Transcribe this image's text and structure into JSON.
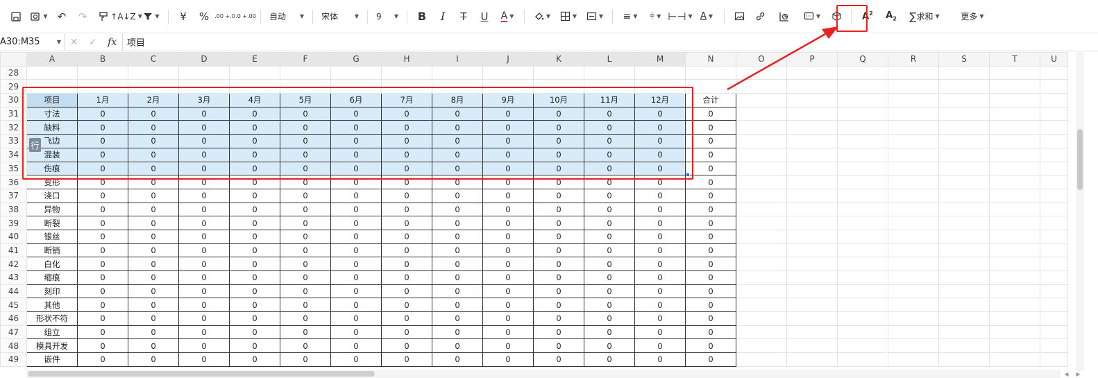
{
  "toolbar": {
    "font_size_preset": "自动",
    "font_name": "宋体",
    "font_size": "9",
    "sum_label": "求和",
    "more_label": "更多",
    "currency_symbol": "¥",
    "percent_symbol": "%",
    "dec_increase": ".00 +.0",
    "dec_decrease": ".0 +.00",
    "highlight_color": "#e8221e",
    "font_color_bar": "#e03030"
  },
  "formula_bar": {
    "name_box": "A30:M35",
    "fx_label": "fx",
    "content": "项目"
  },
  "sheet": {
    "columns": [
      "A",
      "B",
      "C",
      "D",
      "E",
      "F",
      "G",
      "H",
      "I",
      "J",
      "K",
      "L",
      "M",
      "N",
      "O",
      "P",
      "Q",
      "R",
      "S",
      "T",
      "U"
    ],
    "selected_columns": [
      "A",
      "B",
      "C",
      "D",
      "E",
      "F",
      "G",
      "H",
      "I",
      "J",
      "K",
      "L",
      "M"
    ],
    "header_row": [
      "项目",
      "1月",
      "2月",
      "3月",
      "4月",
      "5月",
      "6月",
      "7月",
      "8月",
      "9月",
      "10月",
      "11月",
      "12月",
      "合计"
    ],
    "header_row_number": "30",
    "empty_rows": [
      "28",
      "29"
    ],
    "rows": [
      {
        "num": "31",
        "label": "寸法"
      },
      {
        "num": "32",
        "label": "缺料"
      },
      {
        "num": "33",
        "label": "飞边"
      },
      {
        "num": "34",
        "label": "混装"
      },
      {
        "num": "35",
        "label": "伤痕"
      },
      {
        "num": "36",
        "label": "变形"
      },
      {
        "num": "37",
        "label": "浇口"
      },
      {
        "num": "38",
        "label": "异物"
      },
      {
        "num": "39",
        "label": "断裂"
      },
      {
        "num": "40",
        "label": "银丝"
      },
      {
        "num": "41",
        "label": "断销"
      },
      {
        "num": "42",
        "label": "白化"
      },
      {
        "num": "43",
        "label": "缩痕"
      },
      {
        "num": "44",
        "label": "刻印"
      },
      {
        "num": "45",
        "label": "其他"
      },
      {
        "num": "46",
        "label": "形状不符"
      },
      {
        "num": "47",
        "label": "组立"
      },
      {
        "num": "48",
        "label": "模具开发"
      },
      {
        "num": "49",
        "label": "嵌件"
      }
    ],
    "cell_value": "0",
    "row_tag": "行"
  },
  "colors": {
    "selection_fill": "#d7ebf8",
    "annotation_red": "#e8221e",
    "fill_handle": "#1e6fd9"
  }
}
